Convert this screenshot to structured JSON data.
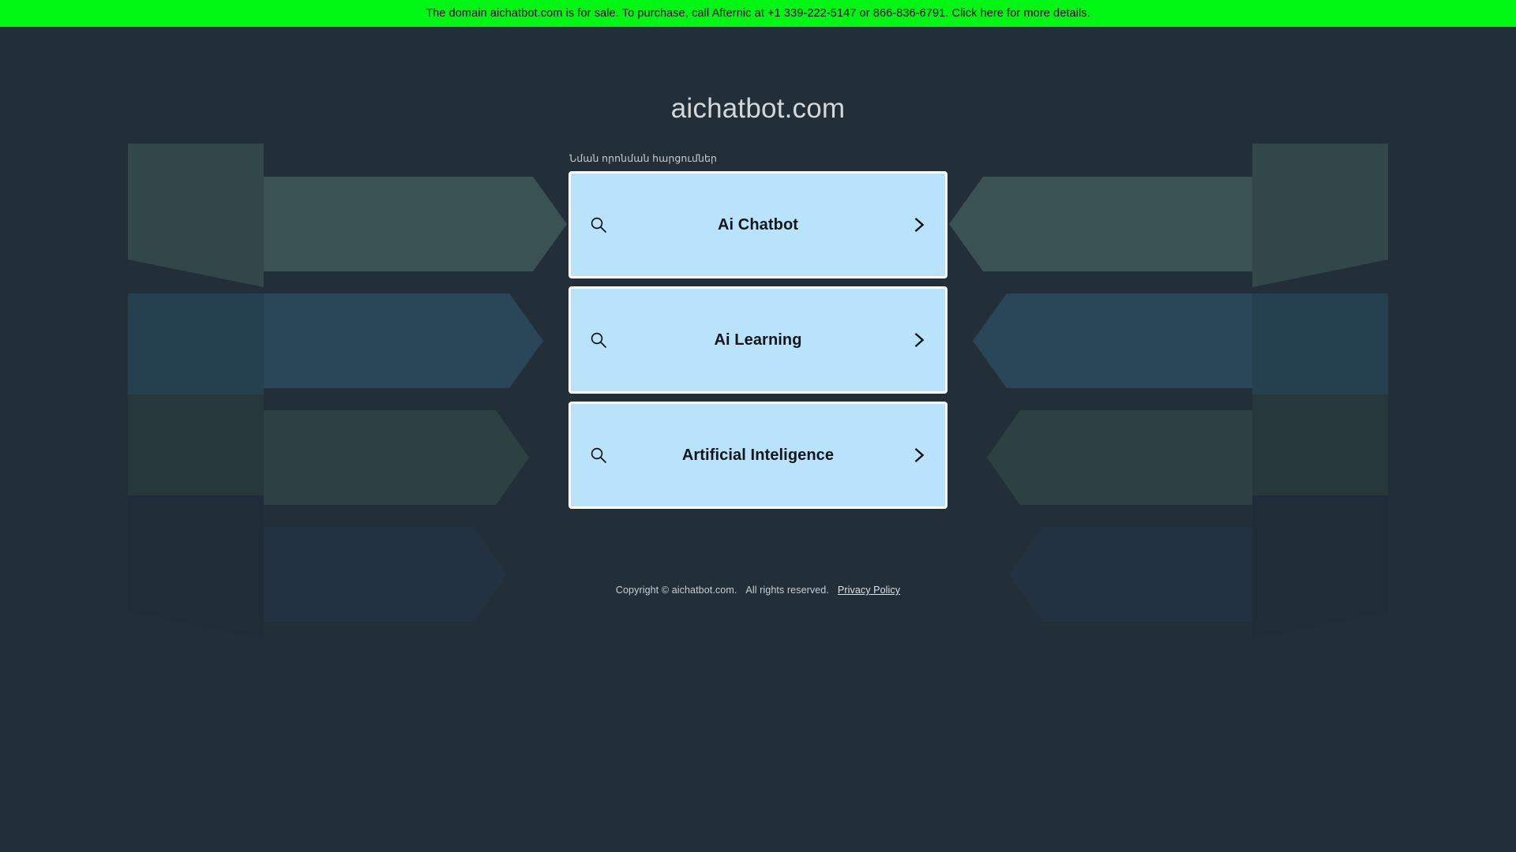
{
  "banner": {
    "text": "The domain aichatbot.com is for sale. To purchase, call Afternic at +1 339-222-5147 or 866-836-6791. Click here for more details.",
    "background_color": "#00f613",
    "text_color": "#000000"
  },
  "page": {
    "title": "aichatbot.com",
    "background_color": "#222f38",
    "title_color": "#d5d8da"
  },
  "suggestions": {
    "label": "Նման որոնման հարցումներ",
    "card_background_color": "#b8e3fa",
    "card_border_color": "#ffffff",
    "card_text_color": "#10161b",
    "items": [
      {
        "label": "Ai Chatbot",
        "search_icon": "search-icon",
        "chevron_icon": "chevron-right-icon"
      },
      {
        "label": "Ai Learning",
        "search_icon": "search-icon",
        "chevron_icon": "chevron-right-icon"
      },
      {
        "label": "Artificial Inteligence",
        "search_icon": "search-icon",
        "chevron_icon": "chevron-right-icon"
      }
    ]
  },
  "footer": {
    "copyright": "Copyright © aichatbot.com.",
    "rights": "All rights reserved.",
    "privacy_link": "Privacy Policy"
  },
  "decoration": {
    "band_colors": [
      "#3a5254",
      "#2a4759",
      "#2d4042",
      "#233240"
    ],
    "band_colors_dim": [
      "#31474a",
      "#25404f",
      "#27383a",
      "#1f2d39"
    ]
  }
}
